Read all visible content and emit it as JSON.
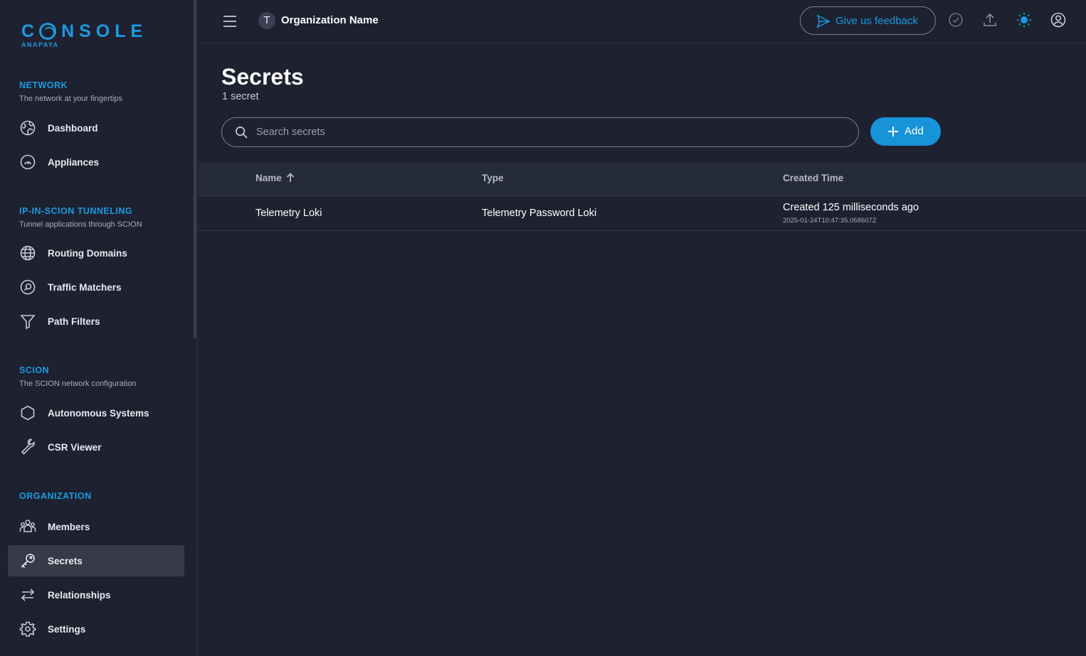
{
  "logo": {
    "text": "C NSOLE",
    "sub": "ANAPAYA"
  },
  "sidebar": {
    "sections": [
      {
        "title": "NETWORK",
        "subtitle": "The network at your fingertips",
        "items": [
          {
            "label": "Dashboard",
            "icon": "dashboard-icon"
          },
          {
            "label": "Appliances",
            "icon": "gauge-icon"
          }
        ]
      },
      {
        "title": "IP-IN-SCION TUNNELING",
        "subtitle": "Tunnel applications through SCION",
        "items": [
          {
            "label": "Routing Domains",
            "icon": "globe-icon"
          },
          {
            "label": "Traffic Matchers",
            "icon": "search-circle-icon"
          },
          {
            "label": "Path Filters",
            "icon": "funnel-icon"
          }
        ]
      },
      {
        "title": "SCION",
        "subtitle": "The SCION network configuration",
        "items": [
          {
            "label": "Autonomous Systems",
            "icon": "hexagon-icon"
          },
          {
            "label": "CSR Viewer",
            "icon": "wrench-icon"
          }
        ]
      },
      {
        "title": "ORGANIZATION",
        "subtitle": "",
        "items": [
          {
            "label": "Members",
            "icon": "users-icon"
          },
          {
            "label": "Secrets",
            "icon": "key-icon",
            "active": true
          },
          {
            "label": "Relationships",
            "icon": "arrows-icon"
          },
          {
            "label": "Settings",
            "icon": "gear-icon"
          }
        ]
      }
    ]
  },
  "topbar": {
    "org_initial": "T",
    "org_name": "Organization Name",
    "feedback_label": "Give us feedback"
  },
  "main": {
    "title": "Secrets",
    "count": "1 secret",
    "search_placeholder": "Search secrets",
    "add_label": "Add"
  },
  "table": {
    "columns": [
      "Name",
      "Type",
      "Created Time"
    ],
    "rows": [
      {
        "name": "Telemetry Loki",
        "type": "Telemetry Password Loki",
        "created": "Created 125 milliseconds ago",
        "timestamp": "2025-01-24T10:47:35.058607Z"
      }
    ]
  },
  "colors": {
    "accent": "#1a9be0",
    "background": "#1e2130",
    "active_item": "#373b48"
  }
}
